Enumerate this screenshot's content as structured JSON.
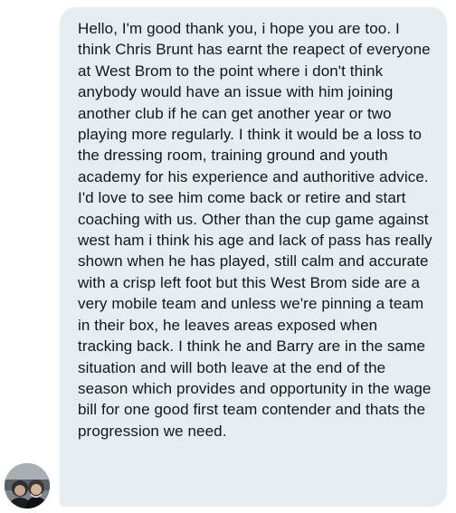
{
  "message": {
    "text": "Hello, I'm good thank you, i hope you are too. I think Chris Brunt has earnt the reapect of everyone at West Brom to the point where i don't think anybody would have an issue with him joining another club if he can get another year or two playing more regularly. I think it would be a loss to the dressing room, training ground and youth academy for his experience and authoritive advice. I'd love to see him come back or retire and start coaching with us. Other than the cup game against west ham i think his age and lack of pass has really shown when he has played, still calm and accurate with a crisp left foot but this West Brom side are a very mobile team and unless we're pinning a team in their box, he leaves areas exposed when tracking back. I think he and Barry are in the same situation and will both leave at the end of the season which provides and opportunity in the wage bill for one good first team contender and thats the progression we need."
  },
  "colors": {
    "bubble_background": "#e6ecf0",
    "text": "#14171a",
    "page_background": "#ffffff"
  }
}
